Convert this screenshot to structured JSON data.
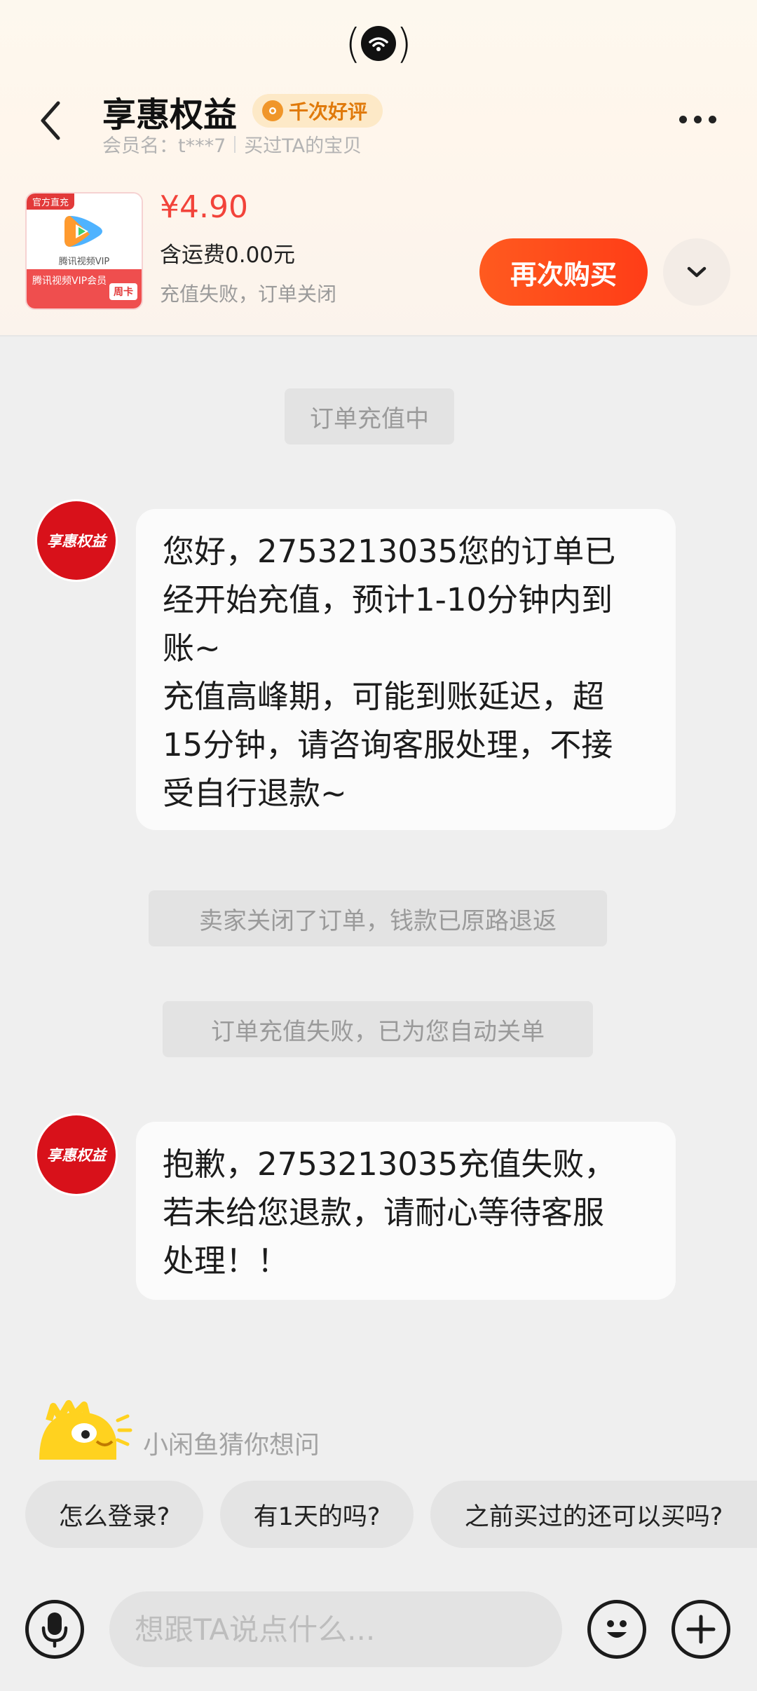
{
  "header": {
    "title": "享惠权益",
    "badge_label": "千次好评",
    "member_label": "会员名：t***7",
    "bought_label": "买过TA的宝贝"
  },
  "product": {
    "thumb_tag": "官方直充",
    "thumb_vip_text": "腾讯视频VIP",
    "thumb_bottom_text": "腾讯视频VIP会员",
    "thumb_week": "周卡",
    "price": "¥4.90",
    "shipping": "含运费0.00元",
    "status": "充值失败，订单关闭",
    "rebuy_label": "再次购买"
  },
  "messages": {
    "sys1": "订单充值中",
    "bubble1": "您好，2753213035您的订单已\n经开始充值，预计1-10分钟内到\n账~\n充值高峰期，可能到账延迟，超\n15分钟，请咨询客服处理，不接\n受自行退款~",
    "sys2": "卖家关闭了订单，钱款已原路退返",
    "sys3": "订单充值失败，已为您自动关单",
    "bubble2": "抱歉，2753213035充值失败，\n若未给您退款，请耐心等待客服\n处理！！",
    "avatar_text": "享惠权益"
  },
  "suggest": {
    "title": "小闲鱼猜你想问",
    "chips": [
      "怎么登录?",
      "有1天的吗?",
      "之前买过的还可以买吗?"
    ]
  },
  "input": {
    "placeholder": "想跟TA说点什么..."
  },
  "colors": {
    "accent": "#ff4a1c",
    "price": "#f2433a",
    "badge_text": "#e07a0b",
    "avatar_red": "#d8111a"
  }
}
